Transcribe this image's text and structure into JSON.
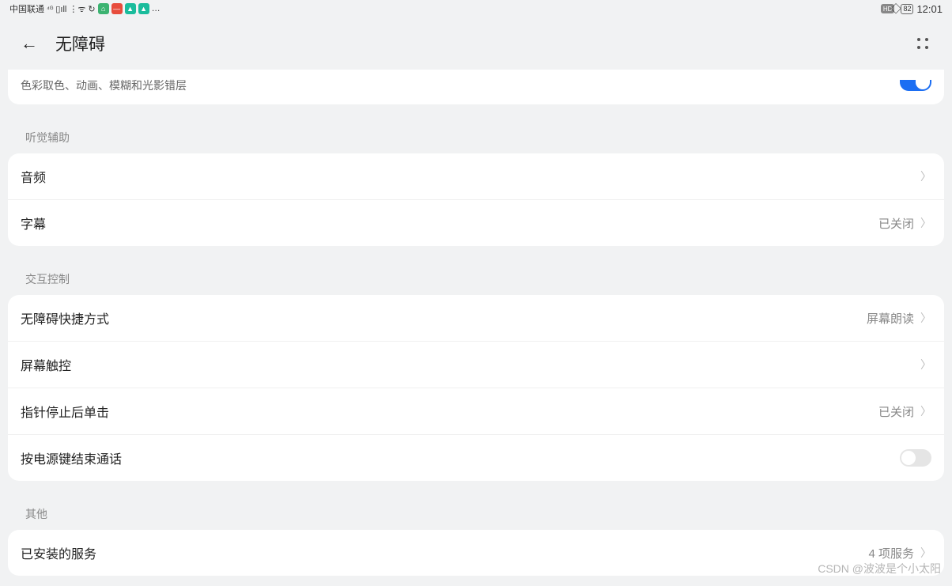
{
  "statusBar": {
    "carrier": "中国联通",
    "signal4g": "4G",
    "time": "12:01",
    "battery": "82",
    "hd": "HD"
  },
  "header": {
    "title": "无障碍"
  },
  "topCard": {
    "label": "色彩取色、动画、模糊和光影错层"
  },
  "sections": {
    "hearing": {
      "title": "听觉辅助",
      "audio": "音频",
      "subtitle": "字幕",
      "subtitleValue": "已关闭"
    },
    "interaction": {
      "title": "交互控制",
      "shortcut": "无障碍快捷方式",
      "shortcutValue": "屏幕朗读",
      "touch": "屏幕触控",
      "pointerClick": "指针停止后单击",
      "pointerValue": "已关闭",
      "powerEnd": "按电源键结束通话"
    },
    "other": {
      "title": "其他",
      "installed": "已安装的服务",
      "installedValue": "4 项服务"
    }
  },
  "watermark": "CSDN @波波是个小太阳"
}
